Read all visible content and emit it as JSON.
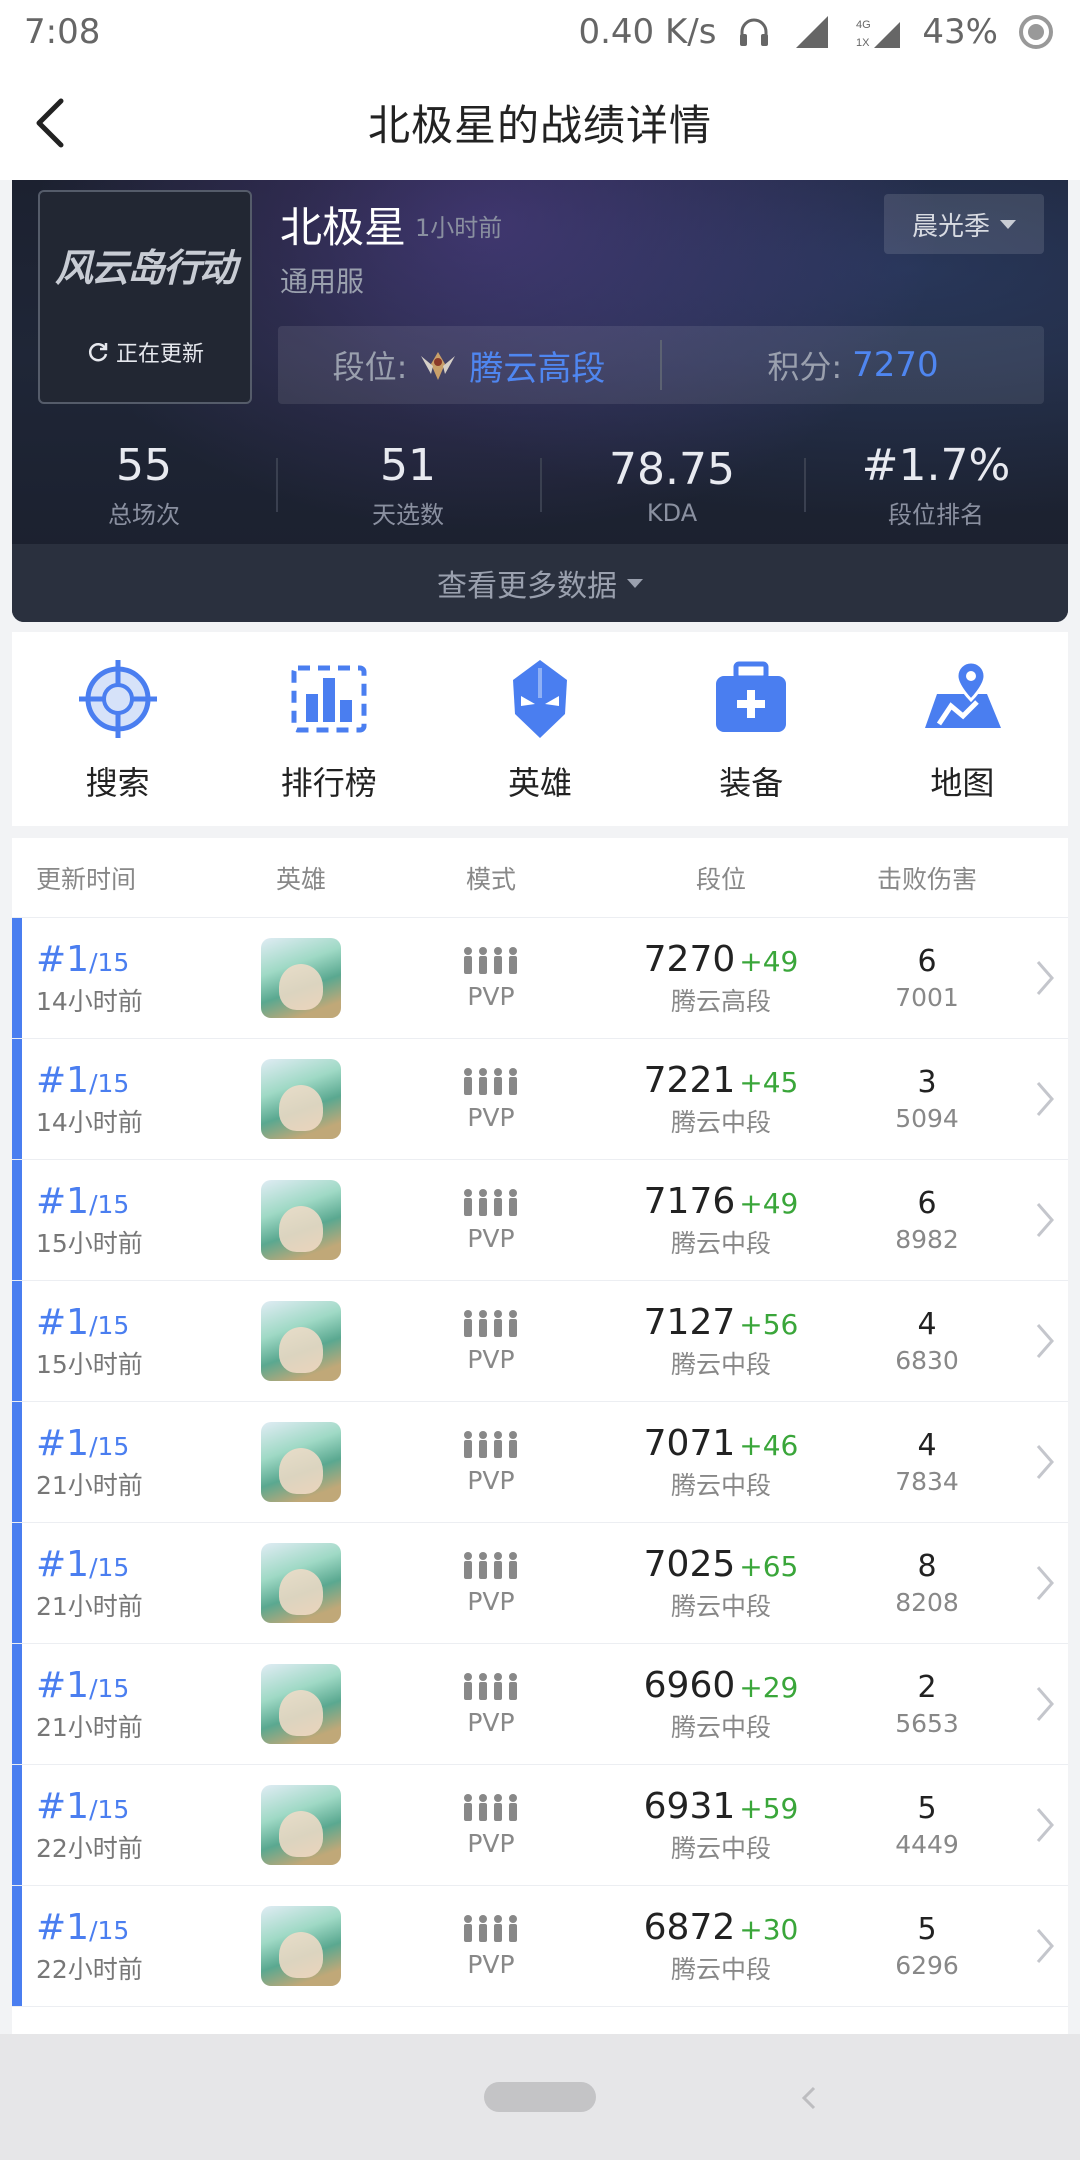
{
  "status_bar": {
    "time": "7:08",
    "network_speed": "0.40 K/s",
    "network_type_top": "4G",
    "network_type_bottom": "1X",
    "battery": "43%"
  },
  "header": {
    "title": "北极星的战绩详情"
  },
  "profile": {
    "game_logo_text": "风云岛行动",
    "updating_label": "正在更新",
    "player_name": "北极星",
    "updated_ago": "1小时前",
    "server": "通用服",
    "season": "晨光季",
    "rank_label": "段位:",
    "rank_value": "腾云高段",
    "score_label": "积分:",
    "score_value": "7270",
    "stats": [
      {
        "value": "55",
        "label": "总场次"
      },
      {
        "value": "51",
        "label": "天选数"
      },
      {
        "value": "78.75",
        "label": "KDA"
      },
      {
        "value": "#1.7%",
        "label": "段位排名"
      }
    ],
    "more_data": "查看更多数据"
  },
  "quick_nav": [
    {
      "label": "搜索",
      "icon": "crosshair-icon"
    },
    {
      "label": "排行榜",
      "icon": "leaderboard-icon"
    },
    {
      "label": "英雄",
      "icon": "hero-helmet-icon"
    },
    {
      "label": "装备",
      "icon": "medkit-icon"
    },
    {
      "label": "地图",
      "icon": "map-pin-icon"
    }
  ],
  "table": {
    "headers": {
      "time": "更新时间",
      "hero": "英雄",
      "mode": "模式",
      "rank": "段位",
      "kills": "击败伤害"
    },
    "rows": [
      {
        "place": "#1",
        "total": "/15",
        "time": "14小时前",
        "mode": "PVP",
        "score": "7270",
        "delta": "+49",
        "tier": "腾云高段",
        "kills": "6",
        "damage": "7001"
      },
      {
        "place": "#1",
        "total": "/15",
        "time": "14小时前",
        "mode": "PVP",
        "score": "7221",
        "delta": "+45",
        "tier": "腾云中段",
        "kills": "3",
        "damage": "5094"
      },
      {
        "place": "#1",
        "total": "/15",
        "time": "15小时前",
        "mode": "PVP",
        "score": "7176",
        "delta": "+49",
        "tier": "腾云中段",
        "kills": "6",
        "damage": "8982"
      },
      {
        "place": "#1",
        "total": "/15",
        "time": "15小时前",
        "mode": "PVP",
        "score": "7127",
        "delta": "+56",
        "tier": "腾云中段",
        "kills": "4",
        "damage": "6830"
      },
      {
        "place": "#1",
        "total": "/15",
        "time": "21小时前",
        "mode": "PVP",
        "score": "7071",
        "delta": "+46",
        "tier": "腾云中段",
        "kills": "4",
        "damage": "7834"
      },
      {
        "place": "#1",
        "total": "/15",
        "time": "21小时前",
        "mode": "PVP",
        "score": "7025",
        "delta": "+65",
        "tier": "腾云中段",
        "kills": "8",
        "damage": "8208"
      },
      {
        "place": "#1",
        "total": "/15",
        "time": "21小时前",
        "mode": "PVP",
        "score": "6960",
        "delta": "+29",
        "tier": "腾云中段",
        "kills": "2",
        "damage": "5653"
      },
      {
        "place": "#1",
        "total": "/15",
        "time": "22小时前",
        "mode": "PVP",
        "score": "6931",
        "delta": "+59",
        "tier": "腾云中段",
        "kills": "5",
        "damage": "4449"
      },
      {
        "place": "#1",
        "total": "/15",
        "time": "22小时前",
        "mode": "PVP",
        "score": "6872",
        "delta": "+30",
        "tier": "腾云中段",
        "kills": "5",
        "damage": "6296"
      }
    ]
  },
  "colors": {
    "accent": "#4a7ef0",
    "positive": "#3aa63a",
    "card_bg": "#1c2130"
  }
}
